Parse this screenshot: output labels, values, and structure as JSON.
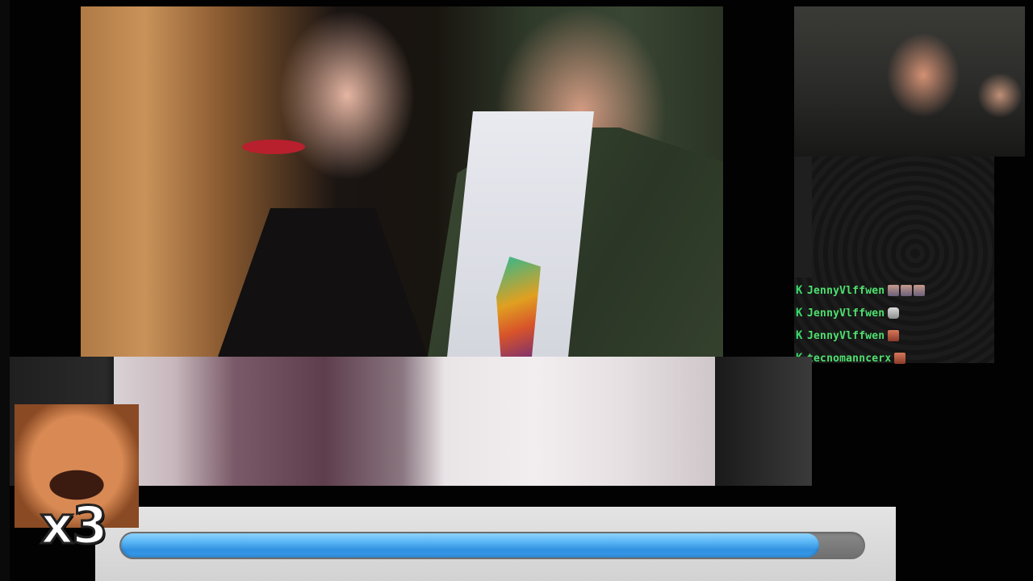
{
  "stream": {
    "main_media": {
      "description_icon": "photo-icon"
    },
    "chat": {
      "messages": [
        {
          "badge": "K",
          "user": "JennyVlffwen",
          "emotes": [
            "face",
            "face",
            "face"
          ]
        },
        {
          "badge": "K",
          "user": "JennyVlffwen",
          "emotes": [
            "cat"
          ]
        },
        {
          "badge": "K",
          "user": "JennyVlffwen",
          "emotes": [
            "mad"
          ]
        },
        {
          "badge": "K",
          "user": "tecnomanncerx",
          "emotes": [
            "mad"
          ]
        }
      ]
    },
    "meme_overlay": {
      "label": "x3"
    },
    "progress": {
      "value": 0.94
    }
  },
  "colors": {
    "chat_name": "#39d353",
    "progress_fill": "#3a9ff0",
    "progress_track": "#7a7a7a",
    "panel_bg": "#dcdcdc"
  }
}
